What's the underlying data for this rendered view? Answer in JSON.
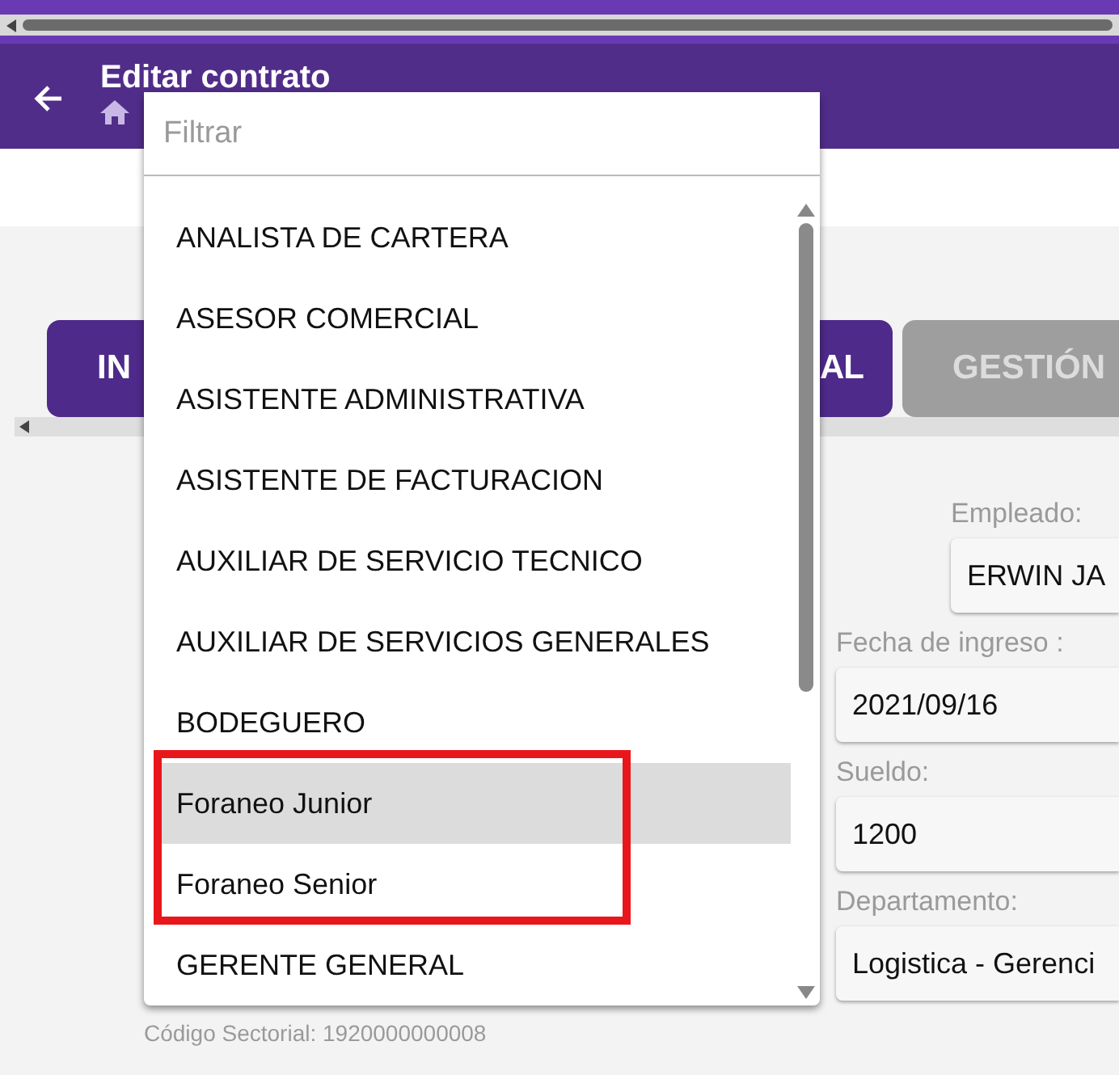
{
  "header": {
    "title": "Editar contrato"
  },
  "tabs": [
    {
      "label": "IN",
      "selected": true
    },
    {
      "label": "AL",
      "selected": true
    },
    {
      "label": "GESTIÓN",
      "selected": false
    }
  ],
  "fields": [
    {
      "label": "Empleado:",
      "value": "ERWIN JA",
      "kind": "narrow"
    },
    {
      "label": "Fecha de ingreso :",
      "value": "2021/09/16",
      "kind": "wide"
    },
    {
      "label": "Sueldo:",
      "value": "1200",
      "kind": "wide"
    },
    {
      "label": "Departamento:",
      "value": "Logistica - Gerenci",
      "kind": "wide"
    }
  ],
  "footer_note": "Código Sectorial: 1920000000008",
  "dropdown": {
    "filter": {
      "placeholder": "Filtrar"
    },
    "options": [
      {
        "label": "ANALISTA DE CARTERA",
        "selected": false
      },
      {
        "label": "ASESOR COMERCIAL",
        "selected": false
      },
      {
        "label": "ASISTENTE ADMINISTRATIVA",
        "selected": false
      },
      {
        "label": "ASISTENTE DE FACTURACION",
        "selected": false
      },
      {
        "label": "AUXILIAR DE SERVICIO TECNICO",
        "selected": false
      },
      {
        "label": "AUXILIAR DE SERVICIOS GENERALES",
        "selected": false
      },
      {
        "label": "BODEGUERO",
        "selected": false
      },
      {
        "label": "Foraneo Junior",
        "selected": true
      },
      {
        "label": "Foraneo Senior",
        "selected": false
      },
      {
        "label": "GERENTE GENERAL",
        "selected": false
      }
    ]
  }
}
